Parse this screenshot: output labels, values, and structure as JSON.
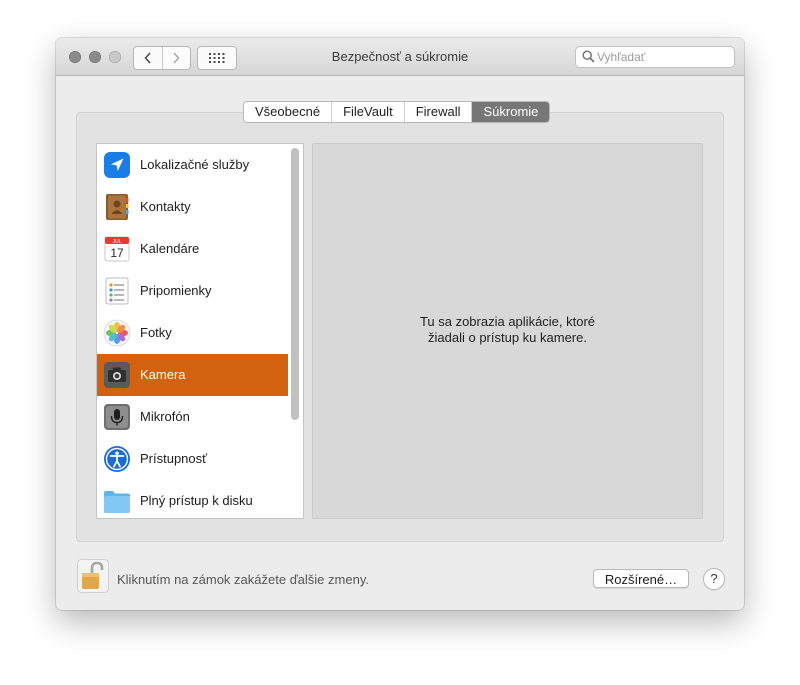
{
  "window": {
    "title": "Bezpečnosť a súkromie"
  },
  "toolbar": {
    "back_icon": "chevron-left-icon",
    "forward_icon": "chevron-right-icon",
    "grid_icon": "grid-icon"
  },
  "search": {
    "placeholder": "Vyhľadať",
    "value": ""
  },
  "tabs": [
    {
      "label": "Všeobecné",
      "active": false
    },
    {
      "label": "FileVault",
      "active": false
    },
    {
      "label": "Firewall",
      "active": false
    },
    {
      "label": "Súkromie",
      "active": true
    }
  ],
  "privacy_list": {
    "items": [
      {
        "label": "Lokalizačné služby",
        "icon": "location-icon"
      },
      {
        "label": "Kontakty",
        "icon": "contacts-icon"
      },
      {
        "label": "Kalendáre",
        "icon": "calendar-icon",
        "icon_month": "JUL",
        "icon_day": "17"
      },
      {
        "label": "Pripomienky",
        "icon": "reminders-icon"
      },
      {
        "label": "Fotky",
        "icon": "photos-icon"
      },
      {
        "label": "Kamera",
        "icon": "camera-icon",
        "selected": true
      },
      {
        "label": "Mikrofón",
        "icon": "microphone-icon"
      },
      {
        "label": "Prístupnosť",
        "icon": "accessibility-icon"
      },
      {
        "label": "Plný prístup k disku",
        "icon": "folder-icon"
      }
    ],
    "selection_color": "#d2620f"
  },
  "detail": {
    "message_line1": "Tu sa zobrazia aplikácie, ktoré",
    "message_line2": "žiadali o prístup ku kamere."
  },
  "footer": {
    "lock_icon": "unlocked-padlock-icon",
    "lock_text": "Kliknutím na zámok zakážete ďalšie zmeny.",
    "advanced_label": "Rozšírené…",
    "help_label": "?"
  }
}
